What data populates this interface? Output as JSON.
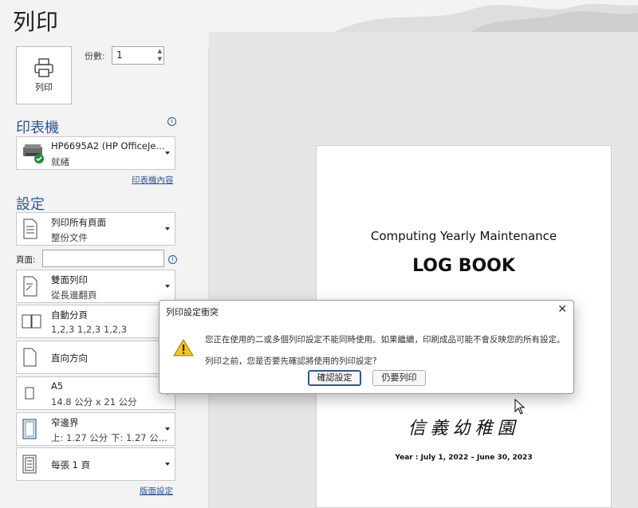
{
  "title": "列印",
  "print_button": {
    "label": "列印",
    "icon": "printer-icon"
  },
  "copies": {
    "label": "份數:",
    "value": "1"
  },
  "printer": {
    "heading": "印表機",
    "name": "HP6695A2 (HP OfficeJe...",
    "status": "就緒",
    "properties_link": "印表機內容"
  },
  "settings": {
    "heading": "設定",
    "range": {
      "line1": "列印所有頁面",
      "line2": "整份文件"
    },
    "pages_label": "頁面:",
    "pages_value": "",
    "duplex": {
      "line1": "雙面列印",
      "line2": "從長邊翻頁"
    },
    "collate": {
      "line1": "自動分頁",
      "line2": "1,2,3    1,2,3    1,2,3"
    },
    "orientation": {
      "line1": "直向方向"
    },
    "paper": {
      "line1": "A5",
      "line2": "14.8 公分 x 21 公分"
    },
    "margins": {
      "line1": "窄邊界",
      "line2": "上: 1.27 公分 下: 1.27 公..."
    },
    "per_sheet": {
      "line1": "每張 1 頁"
    },
    "page_setup_link": "版面設定"
  },
  "preview": {
    "line1": "Computing Yearly Maintenance",
    "line2": "LOG BOOK",
    "calligraphy": "信義幼稚園",
    "year": "Year : July 1, 2022 – June 30, 2023"
  },
  "dialog": {
    "title": "列印設定衝突",
    "message1": "您正在使用的二或多個列印設定不能同時使用。如果繼續，印刷成品可能不會反映您的所有設定。",
    "message2": "列印之前，您是否要先確認將使用的列印設定?",
    "confirm_button": "確認設定",
    "print_anyway_button": "仍要列印"
  },
  "colors": {
    "accent": "#2b579a",
    "warning": "#f5c518"
  }
}
